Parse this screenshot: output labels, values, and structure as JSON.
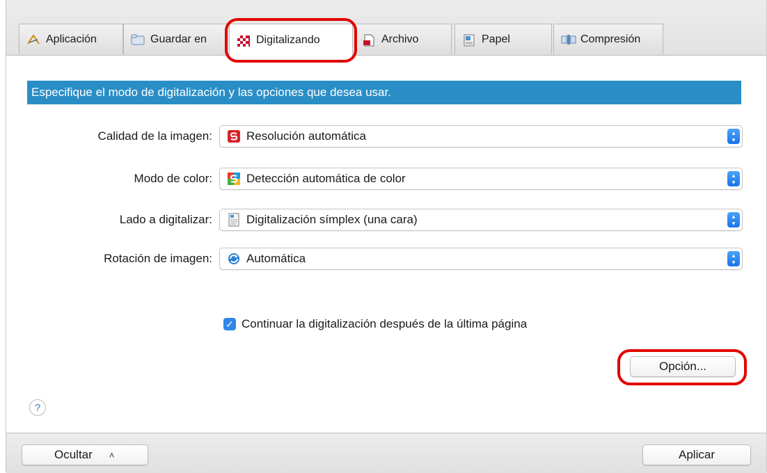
{
  "tabs": [
    {
      "label": "Aplicación",
      "icon": "application-icon"
    },
    {
      "label": "Guardar en",
      "icon": "folder-icon"
    },
    {
      "label": "Digitalizando",
      "icon": "scanning-icon"
    },
    {
      "label": "Archivo",
      "icon": "file-icon"
    },
    {
      "label": "Papel",
      "icon": "paper-icon"
    },
    {
      "label": "Compresión",
      "icon": "compression-icon"
    }
  ],
  "active_tab": "Digitalizando",
  "banner": "Especifique el modo de digitalización y las opciones que desea usar.",
  "settings": [
    {
      "label": "Calidad de la imagen:",
      "value": "Resolución automática",
      "icon": "resolution-icon"
    },
    {
      "label": "Modo de color:",
      "value": "Detección automática de color",
      "icon": "color-mode-icon"
    },
    {
      "label": "Lado a digitalizar:",
      "value": "Digitalización símplex (una cara)",
      "icon": "simplex-icon"
    },
    {
      "label": "Rotación de imagen:",
      "value": "Automática",
      "icon": "rotation-icon"
    }
  ],
  "continue_checkbox": {
    "label": "Continuar la digitalización después de la última página",
    "checked": true
  },
  "option_button": "Opción...",
  "help": "?",
  "footer": {
    "hide_label": "Ocultar",
    "apply_label": "Aplicar"
  },
  "colors": {
    "accent": "#2a8ec6",
    "callout": "#e10600",
    "checkbox": "#2f86e8"
  }
}
